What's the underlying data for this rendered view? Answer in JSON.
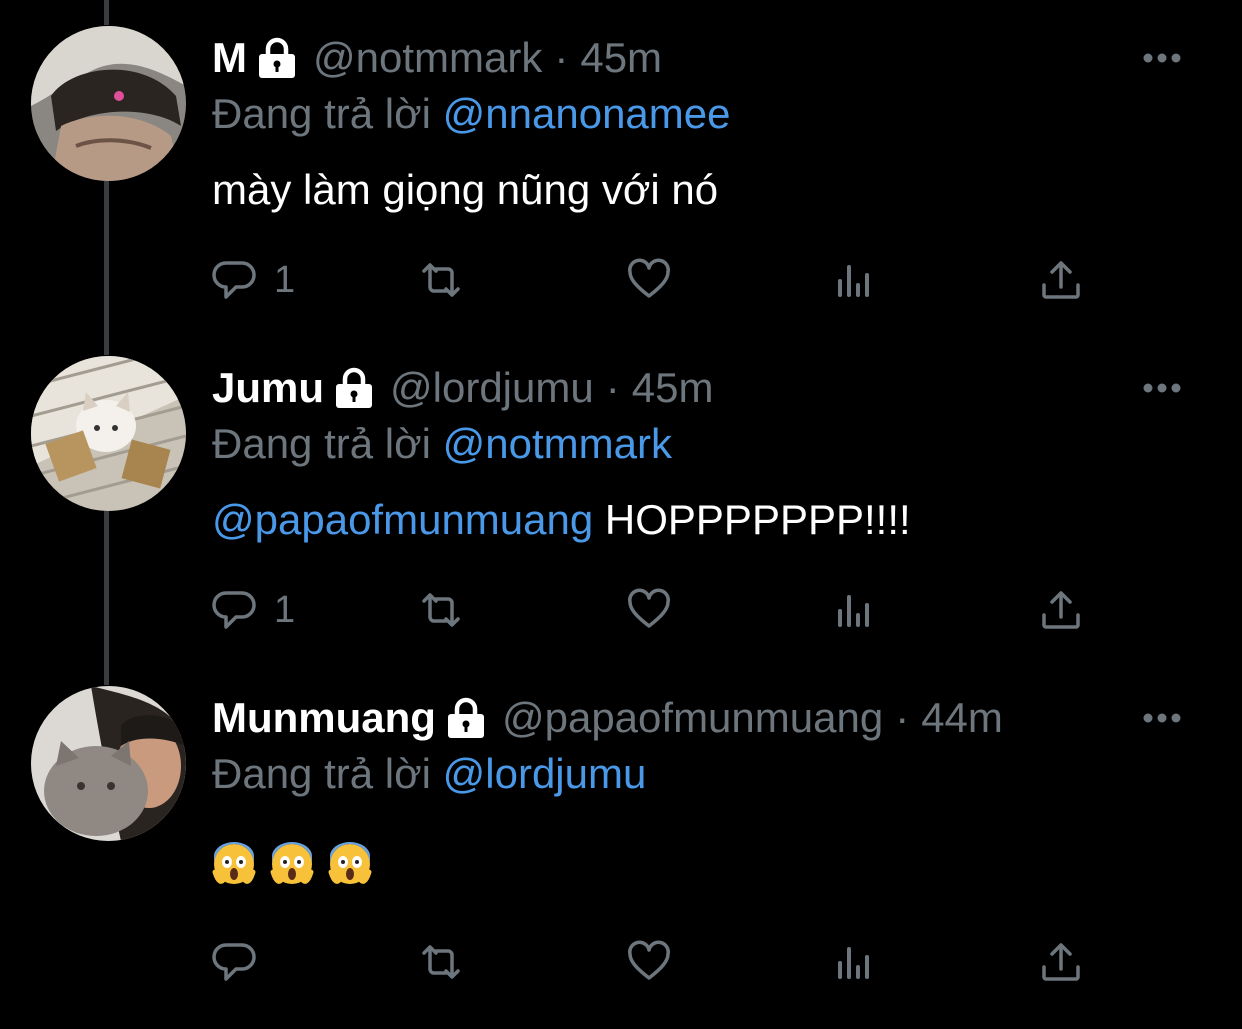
{
  "reply_prefix": "Đang trả lời",
  "colors": {
    "background": "#000000",
    "text": "#ffffff",
    "muted": "#6e767d",
    "link": "#4a99e9",
    "thread_line": "#3a3d40"
  },
  "tweets": [
    {
      "display_name": "M",
      "handle": "@notmmark",
      "separator": "·",
      "time": "45m",
      "reply_to": "@nnanonamee",
      "body": "mày làm giọng nũng với nó",
      "reply_count": "1",
      "protected": true
    },
    {
      "display_name": "Jumu",
      "handle": "@lordjumu",
      "separator": "·",
      "time": "45m",
      "reply_to": "@notmmark",
      "body_mention": "@papaofmunmuang",
      "body": "HOPPPPPPP!!!!",
      "reply_count": "1",
      "protected": true
    },
    {
      "display_name": "Munmuang",
      "handle": "@papaofmunmuang",
      "separator": "·",
      "time": "44m",
      "reply_to": "@lordjumu",
      "body_emoji": [
        "scream-emoji",
        "scream-emoji",
        "scream-emoji"
      ],
      "reply_count": "",
      "protected": true
    }
  ],
  "icons": {
    "lock": "lock-icon",
    "more": "more-icon",
    "reply": "reply-icon",
    "retweet": "retweet-icon",
    "like": "heart-icon",
    "analytics": "analytics-icon",
    "share": "share-icon"
  }
}
